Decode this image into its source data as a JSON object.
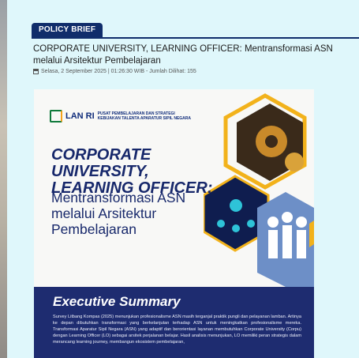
{
  "section_tab": "POLICY BRIEF",
  "article": {
    "title": "CORPORATE UNIVERSITY, LEARNING OFFICER: Mentransformasi ASN melalui Arsitektur Pembelajaran",
    "meta": "Selasa, 2 September 2025 | 01:26:30 WIB - Jumlah Dilihat: 155"
  },
  "poster": {
    "logo_text": "LAN RI",
    "logo_subtitle": "PUSAT PEMBELAJARAN DAN STRATEGI KEBIJAKAN TALENTA APARATUR SIPIL NEGARA",
    "heading": "CORPORATE UNIVERSITY, LEARNING OFFICER:",
    "subheading": "Mentransformasi ASN melalui Arsitektur Pembelajaran",
    "summary_title": "Executive Summary",
    "summary_text": "Survey Litbang Kompas (2025) menunjukan profesionalisme ASN masih terganjal praktik pungli dan pelayanan lamban. Artinya ke depan dibutuhkan transformasi yang berkelanjutan terhadap ASN untuk meningkatkan profesionalisme mereka. Transformasi Aparatur Sipil Negara (ASN) yang adaptif dan berorientasi layanan membutuhkan Corporate University (Corpu) dengan Learning Officer (LO) sebagai arsitek perjalanan belajar. Hasil analisis menunjukan, LO memiliki peran strategis dalam merancang learning journey, membangun ekosistem pembelajaran,"
  },
  "colors": {
    "navy": "#102d6b",
    "poster_navy": "#1e2c70",
    "gold": "#f2b21b",
    "page_bg": "#dff7fb"
  },
  "icons": [
    "calendar-icon",
    "lan-ri-logo",
    "gears-icon",
    "people-network-icon",
    "team-icon"
  ]
}
